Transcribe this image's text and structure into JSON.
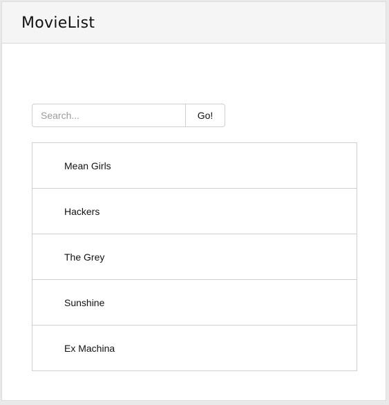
{
  "app": {
    "brand": "MovieList"
  },
  "search": {
    "placeholder": "Search...",
    "value": "",
    "button_label": "Go!"
  },
  "movies": [
    {
      "title": "Mean Girls"
    },
    {
      "title": "Hackers"
    },
    {
      "title": "The Grey"
    },
    {
      "title": "Sunshine"
    },
    {
      "title": "Ex Machina"
    }
  ]
}
